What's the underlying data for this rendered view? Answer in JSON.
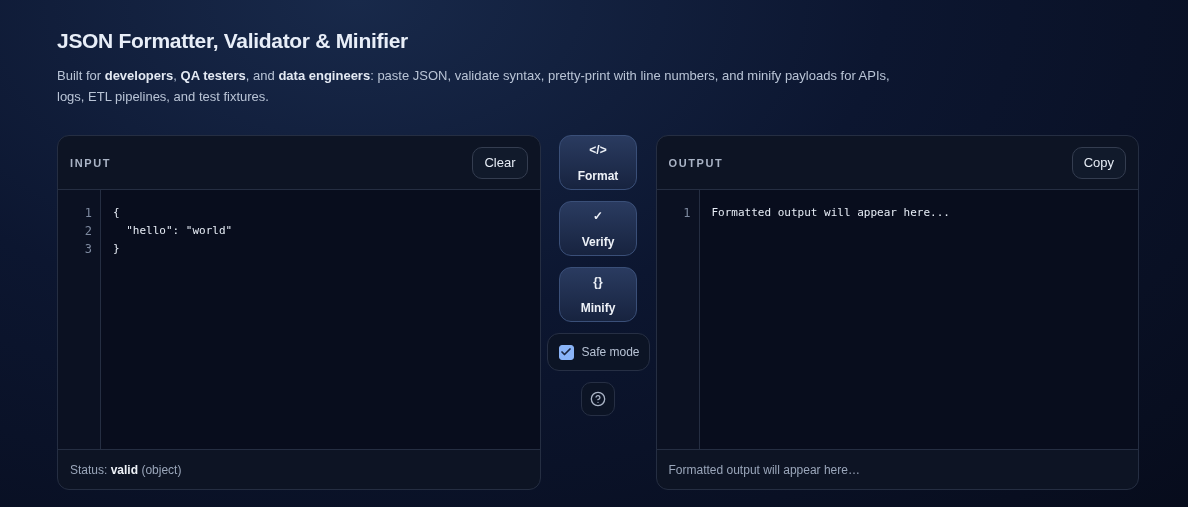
{
  "header": {
    "title": "JSON Formatter, Validator & Minifier",
    "description": "Built for **developers**, **QA testers**, and **data engineers**: paste JSON, validate syntax, pretty-print with line numbers, and minify payloads for APIs, logs, ETL pipelines, and test fixtures."
  },
  "input_panel": {
    "label": "INPUT",
    "button": "Clear",
    "line_numbers": [
      "1",
      "2",
      "3"
    ],
    "lines": [
      "{",
      "  \"hello\": \"world\"",
      "}"
    ],
    "footer": "Status: **valid** (object)"
  },
  "actions": [
    {
      "symbol": "</>",
      "label": "Format"
    },
    {
      "symbol": "✓",
      "label": "Verify"
    },
    {
      "symbol": "{}",
      "label": "Minify"
    }
  ],
  "safe_mode": {
    "label": "Safe mode",
    "checked": true
  },
  "output_panel": {
    "label": "OUTPUT",
    "button": "Copy",
    "line_numbers": [
      "1"
    ],
    "lines": [
      "Formatted output will appear here..."
    ],
    "footer": "Formatted output will appear here…"
  }
}
